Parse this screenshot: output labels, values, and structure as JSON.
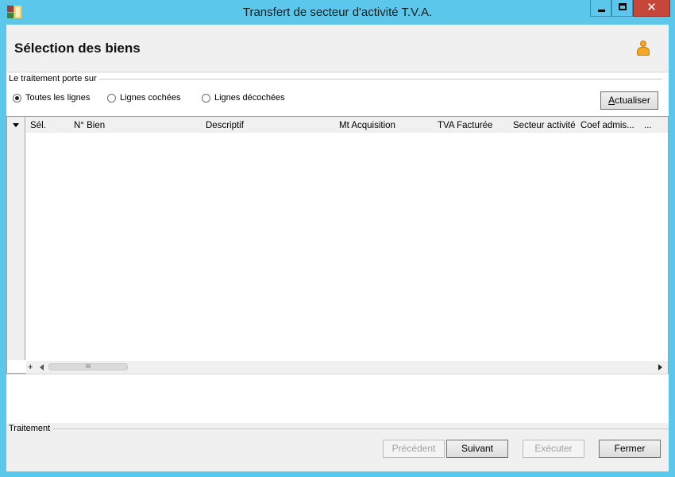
{
  "window": {
    "title": "Transfert de secteur d'activité T.V.A.",
    "close_glyph": "✕"
  },
  "header": {
    "page_title": "Sélection des biens"
  },
  "options": {
    "group_label": "Le traitement porte sur",
    "radios": [
      {
        "label": "Toutes les lignes",
        "checked": true
      },
      {
        "label": "Lignes cochées",
        "checked": false
      },
      {
        "label": "Lignes décochées",
        "checked": false
      }
    ],
    "refresh_label": "Actualiser"
  },
  "grid": {
    "columns": [
      "Sél.",
      "N° Bien",
      "Descriptif",
      "Mt Acquisition",
      "TVA Facturée",
      "Secteur activité",
      "Coef admis...",
      "..."
    ],
    "rows": [],
    "expand_glyph": "+",
    "thumb_glyph": "III"
  },
  "footer": {
    "group_label": "Traitement",
    "prev_label": "Précédent",
    "next_label": "Suivant",
    "execute_label": "Exécuter",
    "close_label": "Fermer",
    "prev_enabled": false,
    "execute_enabled": false
  },
  "colors": {
    "titlebar": "#5bc8eb",
    "close_button": "#c7463a",
    "user_icon": "#f5a623"
  },
  "icons": [
    "app-icon",
    "minimize-icon",
    "maximize-icon",
    "close-icon",
    "user-icon",
    "grid-dropdown-icon",
    "expand-icon",
    "scroll-left-icon",
    "scroll-right-icon"
  ]
}
